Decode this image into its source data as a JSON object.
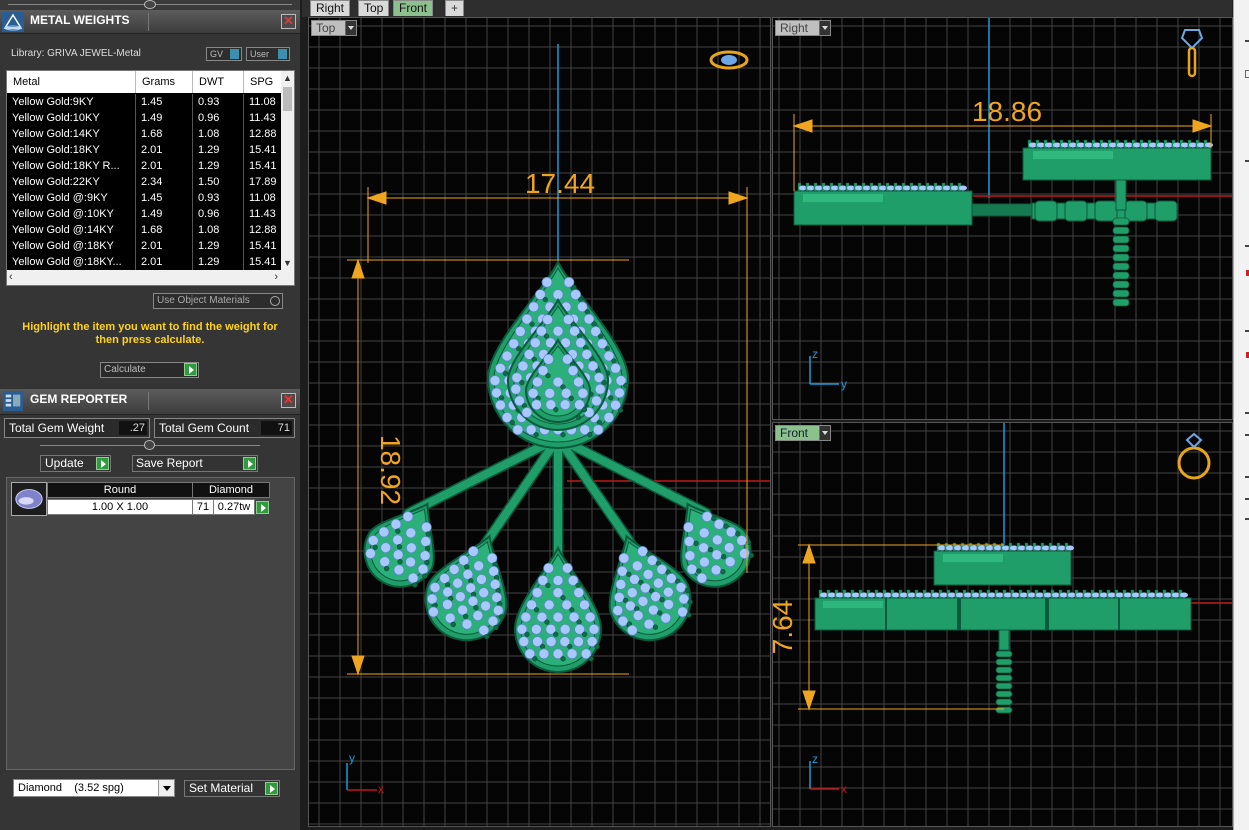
{
  "metal_panel": {
    "title": "METAL WEIGHTS",
    "close": "✕",
    "library": "Library: GRIVA JEWEL-Metal",
    "gv_button": "GV",
    "user_button": "User",
    "columns": [
      "Metal",
      "Grams",
      "DWT",
      "SPG"
    ],
    "rows": [
      [
        "Yellow Gold:9KY",
        "1.45",
        "0.93",
        "11.08"
      ],
      [
        "Yellow Gold:10KY",
        "1.49",
        "0.96",
        "11.43"
      ],
      [
        "Yellow Gold:14KY",
        "1.68",
        "1.08",
        "12.88"
      ],
      [
        "Yellow Gold:18KY",
        "2.01",
        "1.29",
        "15.41"
      ],
      [
        "Yellow Gold:18KY R...",
        "2.01",
        "1.29",
        "15.41"
      ],
      [
        "Yellow Gold:22KY",
        "2.34",
        "1.50",
        "17.89"
      ],
      [
        "Yellow Gold @:9KY",
        "1.45",
        "0.93",
        "11.08"
      ],
      [
        "Yellow Gold @:10KY",
        "1.49",
        "0.96",
        "11.43"
      ],
      [
        "Yellow Gold @:14KY",
        "1.68",
        "1.08",
        "12.88"
      ],
      [
        "Yellow Gold @:18KY",
        "2.01",
        "1.29",
        "15.41"
      ],
      [
        "Yellow Gold @:18KY...",
        "2.01",
        "1.29",
        "15.41"
      ]
    ],
    "use_object_materials": "Use Object Materials",
    "hint": "Highlight the item you want to find the weight for then press calculate.",
    "calculate": "Calculate"
  },
  "gem_panel": {
    "title": "GEM REPORTER",
    "close": "✕",
    "total_weight_label": "Total Gem Weight",
    "total_weight_value": ".27",
    "total_count_label": "Total Gem Count",
    "total_count_value": "71",
    "update": "Update",
    "save_report": "Save Report",
    "gems": [
      {
        "shape": "Round",
        "material": "Diamond",
        "size": "1.00 X 1.00",
        "count": "71",
        "weight": "0.27tw"
      }
    ],
    "material_select": "Diamond    (3.52 spg)",
    "set_material": "Set Material"
  },
  "tabs": [
    "Right",
    "Top",
    "Front",
    "+"
  ],
  "active_tab": "Front",
  "viewports": {
    "top": {
      "label": "Top",
      "width_dim": "17.44",
      "height_dim": "18.92",
      "axis_y": "y",
      "axis_x": "x"
    },
    "right": {
      "label": "Right",
      "width_dim": "18.86",
      "axis_z": "z",
      "axis_y": "y"
    },
    "front": {
      "label": "Front",
      "height_dim": "7.64",
      "axis_z": "z",
      "axis_x": "x"
    }
  },
  "colors": {
    "grid": "#4a4a4a",
    "metal": "#1f9e6a",
    "gem": "#a8c8ff",
    "dimension": "#f0a520",
    "axis_blue": "#1e9ad6",
    "axis_red": "#c01818",
    "accent_green": "#8cc08c"
  }
}
